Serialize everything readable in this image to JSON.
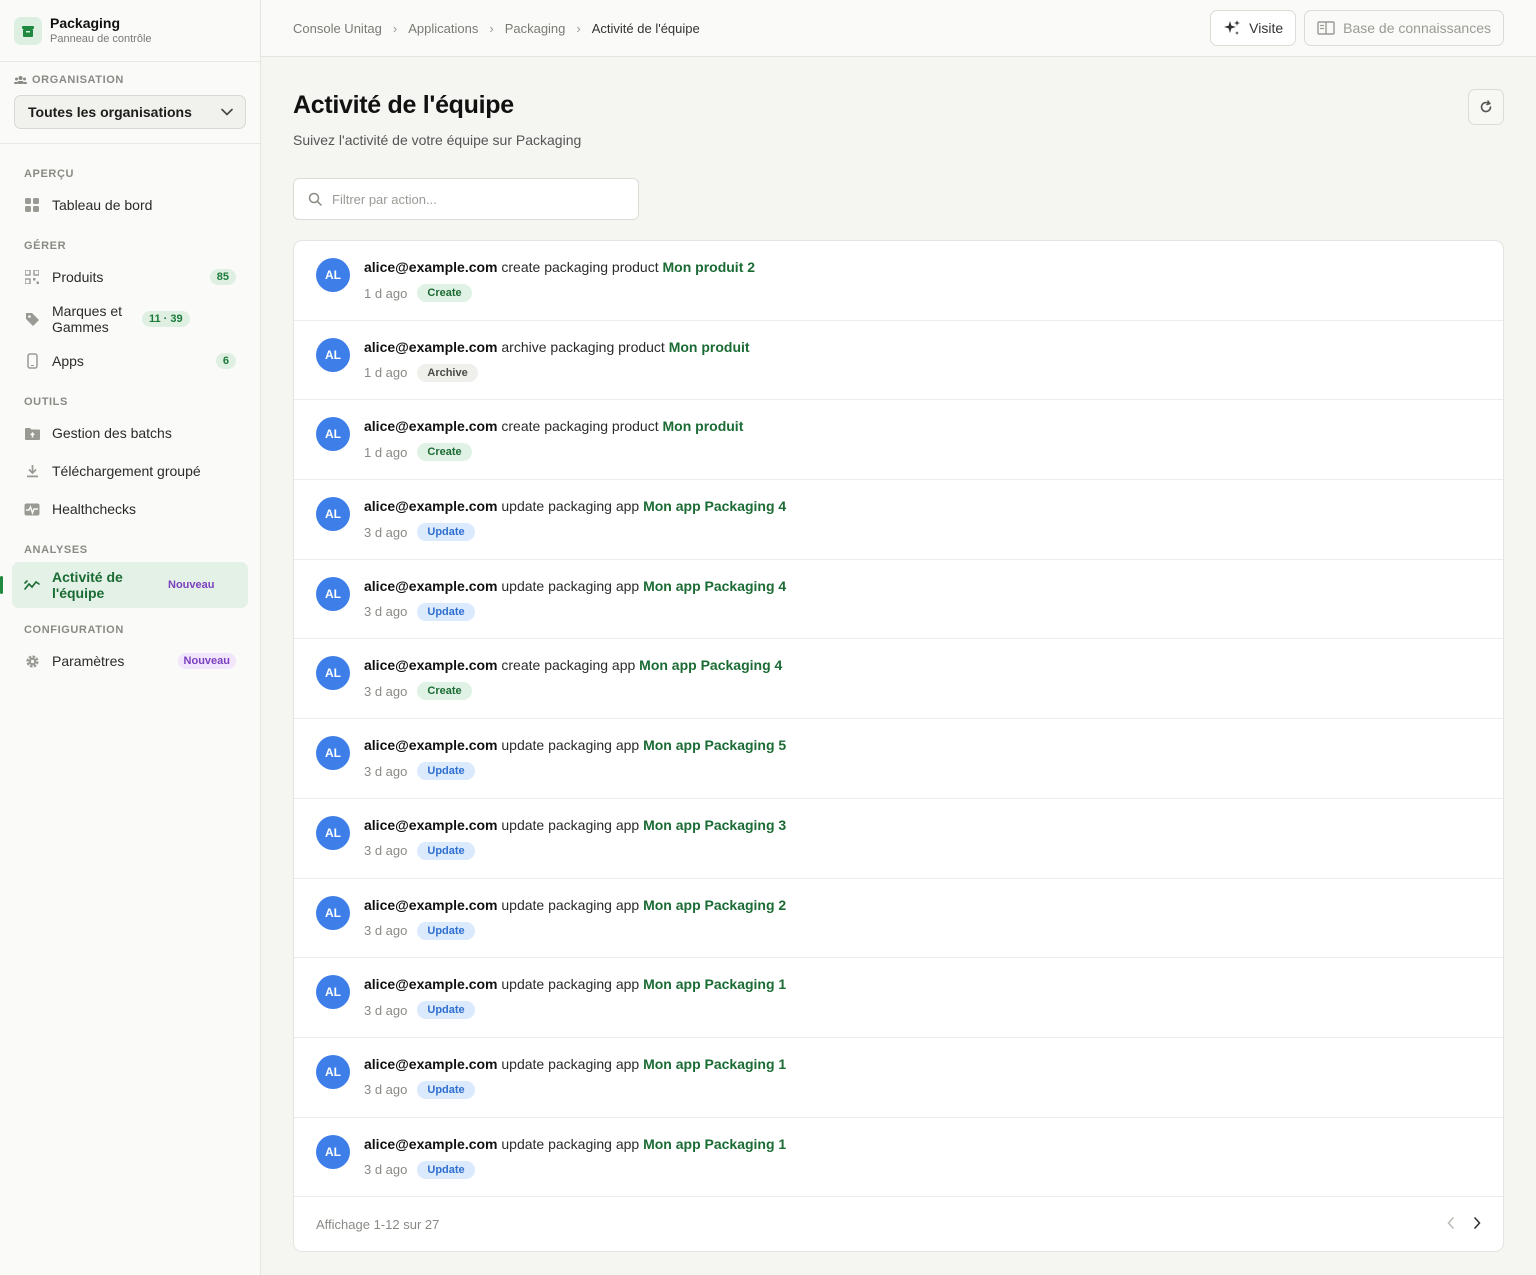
{
  "brand": {
    "title": "Packaging",
    "subtitle": "Panneau de contrôle"
  },
  "organization": {
    "label": "ORGANISATION",
    "selected": "Toutes les organisations"
  },
  "nav": {
    "groups": {
      "overview": "APERÇU",
      "manage": "GÉRER",
      "tools": "OUTILS",
      "analytics": "ANALYSES",
      "config": "CONFIGURATION"
    },
    "items": {
      "dashboard": "Tableau de bord",
      "products": "Produits",
      "products_count": "85",
      "brands": "Marques et Gammes",
      "brands_count": "11 · 39",
      "apps": "Apps",
      "apps_count": "6",
      "batches": "Gestion des batchs",
      "bulk_download": "Téléchargement groupé",
      "healthchecks": "Healthchecks",
      "team_activity": "Activité de l'équipe",
      "team_activity_badge": "Nouveau",
      "settings": "Paramètres",
      "settings_badge": "Nouveau"
    }
  },
  "breadcrumb": [
    "Console Unitag",
    "Applications",
    "Packaging",
    "Activité de l'équipe"
  ],
  "topbar": {
    "tour": "Visite",
    "knowledge_base": "Base de connaissances"
  },
  "page": {
    "title": "Activité de l'équipe",
    "subtitle": "Suivez l'activité de votre équipe sur Packaging",
    "filter_placeholder": "Filtrer par action..."
  },
  "activities": [
    {
      "initials": "AL",
      "user": "alice@example.com",
      "action": " create packaging product ",
      "target": "Mon produit 2",
      "ago": "1 d ago",
      "tag": "Create"
    },
    {
      "initials": "AL",
      "user": "alice@example.com",
      "action": " archive packaging product ",
      "target": "Mon produit",
      "ago": "1 d ago",
      "tag": "Archive"
    },
    {
      "initials": "AL",
      "user": "alice@example.com",
      "action": " create packaging product ",
      "target": "Mon produit",
      "ago": "1 d ago",
      "tag": "Create"
    },
    {
      "initials": "AL",
      "user": "alice@example.com",
      "action": " update packaging app ",
      "target": "Mon app Packaging 4",
      "ago": "3 d ago",
      "tag": "Update"
    },
    {
      "initials": "AL",
      "user": "alice@example.com",
      "action": " update packaging app ",
      "target": "Mon app Packaging 4",
      "ago": "3 d ago",
      "tag": "Update"
    },
    {
      "initials": "AL",
      "user": "alice@example.com",
      "action": " create packaging app ",
      "target": "Mon app Packaging 4",
      "ago": "3 d ago",
      "tag": "Create"
    },
    {
      "initials": "AL",
      "user": "alice@example.com",
      "action": " update packaging app ",
      "target": "Mon app Packaging 5",
      "ago": "3 d ago",
      "tag": "Update"
    },
    {
      "initials": "AL",
      "user": "alice@example.com",
      "action": " update packaging app ",
      "target": "Mon app Packaging 3",
      "ago": "3 d ago",
      "tag": "Update"
    },
    {
      "initials": "AL",
      "user": "alice@example.com",
      "action": " update packaging app ",
      "target": "Mon app Packaging 2",
      "ago": "3 d ago",
      "tag": "Update"
    },
    {
      "initials": "AL",
      "user": "alice@example.com",
      "action": " update packaging app ",
      "target": "Mon app Packaging 1",
      "ago": "3 d ago",
      "tag": "Update"
    },
    {
      "initials": "AL",
      "user": "alice@example.com",
      "action": " update packaging app ",
      "target": "Mon app Packaging 1",
      "ago": "3 d ago",
      "tag": "Update"
    },
    {
      "initials": "AL",
      "user": "alice@example.com",
      "action": " update packaging app ",
      "target": "Mon app Packaging 1",
      "ago": "3 d ago",
      "tag": "Update"
    }
  ],
  "pagination": {
    "summary": "Affichage 1-12 sur 27"
  },
  "colors": {
    "accent": "#1b6b34",
    "avatar": "#3d7ee8",
    "update": "#2f6fcf",
    "new_badge": "#7b3fbf"
  }
}
